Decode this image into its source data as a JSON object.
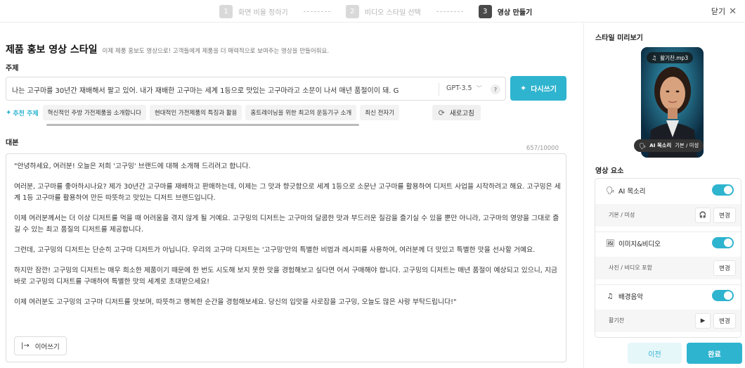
{
  "header": {
    "steps": [
      {
        "num": "1",
        "label": "화면 비율 정하기"
      },
      {
        "num": "2",
        "label": "비디오 스타일 선택"
      },
      {
        "num": "3",
        "label": "영상 만들기"
      }
    ],
    "close_label": "닫기",
    "close_icon": "close-icon"
  },
  "main": {
    "title": "제품 홍보 영상 스타일",
    "subtitle": "이제 제품 홍보도 영상으로! 고객들에게 제품을 더 매력적으로 보여주는 영상을 만들어줘요.",
    "topic_label": "주제",
    "topic_value": "나는 고구마를 30년간 재배해서 팔고 있어. 내가 재배한 고구마는 세계 1등으로 맛있는 고구마라고 소문이 나서 매년 품절이이 돼. G",
    "model": "GPT-3.5",
    "help": "?",
    "rewrite_label": "다시쓰기",
    "recommend_label": "추천 주제",
    "chips": [
      "혁신적인 주방 가전제품을 소개합니다",
      "현대적인 가전제품의 특징과 활용",
      "홈트레이닝을 위한 최고의 운동기구 소개",
      "최신 전자기"
    ],
    "refresh_label": "새로고침",
    "script_label": "대본",
    "script_count": "657/10000",
    "script_paragraphs": [
      "\"안녕하세요, 여러분! 오늘은 저희 '고구밍' 브랜드에 대해 소개해 드리려고 합니다.",
      "여러분, 고구마를 좋아하시나요? 제가 30년간 고구마를 재배하고 판매하는데, 이제는 그 맛과 향긋함으로 세계 1등으로 소문난 고구마를 활용하여 디저트 사업을 시작하려고 해요. 고구밍은 세계 1등 고구마를 활용하여 만든 따뜻하고 맛있는 디저트 브랜드입니다.",
      "이제 여러분께서는 더 이상 디저트를 먹을 때 어려움을 겪지 않게 될 거예요. 고구밍의 디저트는 고구마의 달콤한 맛과 부드러운 질감을 즐기실 수 있을 뿐만 아니라, 고구마의 영양을 그대로 즐길 수 있는 최고 품질의 디저트를 제공합니다.",
      "그런데, 고구밍의 디저트는 단순히 고구마 디저트가 아닙니다. 우리의 고구마 디저트는 '고구밍'만의 특별한 비법과 레시피를 사용하여, 여러분께 더 맛있고 특별한 맛을 선사할 거예요.",
      "하지만 잠깐! 고구밍의 디저트는 매우 희소한 제품이기 때문에 한 번도 시도해 보지 못한 맛을 경험해보고 싶다면 어서 구매해야 합니다. 고구밍의 디저트는 매년 품절이 예상되고 있으니, 지금 바로 고구밍의 디저트를 구매하여 특별한 맛의 세계로 초대받으세요!",
      "이제 여러분도 고구밍의 고구마 디저트를 맛보며, 따뜻하고 행복한 순간을 경험해보세요. 당신의 입맛을 사로잡을 고구밍, 오늘도 많은 사랑 부탁드립니다!\""
    ],
    "continue_label": "이어쓰기"
  },
  "preview": {
    "label": "스타일 미리보기",
    "music_file": "활기찬.mp3",
    "voice_label": "AI 목소리",
    "voice_value": "기본 / 미성"
  },
  "elements": {
    "label": "영상 요소",
    "items": [
      {
        "name": "AI 목소리",
        "icon": "voice-icon",
        "enabled": true,
        "detail": "기본 / 미성",
        "change_label": "변경",
        "action_icon": "headphones-icon"
      },
      {
        "name": "이미지&비디오",
        "icon": "media-icon",
        "enabled": true,
        "detail": "사진 / 비디오 포함",
        "change_label": "변경"
      },
      {
        "name": "배경음악",
        "icon": "music-icon",
        "enabled": true,
        "detail": "활기찬",
        "change_label": "변경",
        "action_icon": "play-icon"
      }
    ]
  },
  "footer": {
    "prev_label": "이전",
    "done_label": "완료"
  },
  "colors": {
    "accent": "#2fb4cf",
    "accent_light": "#e6f7fa"
  }
}
